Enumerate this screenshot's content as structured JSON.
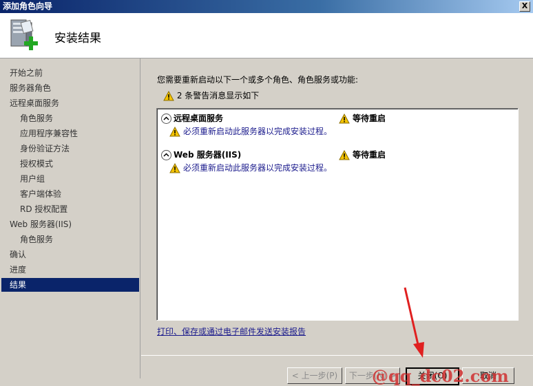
{
  "window": {
    "title": "添加角色向导",
    "close_glyph": "X"
  },
  "header": {
    "title": "安装结果",
    "icon": "server-add-icon"
  },
  "sidebar": {
    "items": [
      {
        "label": "开始之前",
        "sub": false,
        "active": false
      },
      {
        "label": "服务器角色",
        "sub": false,
        "active": false
      },
      {
        "label": "远程桌面服务",
        "sub": false,
        "active": false
      },
      {
        "label": "角色服务",
        "sub": true,
        "active": false
      },
      {
        "label": "应用程序兼容性",
        "sub": true,
        "active": false
      },
      {
        "label": "身份验证方法",
        "sub": true,
        "active": false
      },
      {
        "label": "授权模式",
        "sub": true,
        "active": false
      },
      {
        "label": "用户组",
        "sub": true,
        "active": false
      },
      {
        "label": "客户端体验",
        "sub": true,
        "active": false
      },
      {
        "label": "RD 授权配置",
        "sub": true,
        "active": false
      },
      {
        "label": "Web 服务器(IIS)",
        "sub": false,
        "active": false
      },
      {
        "label": "角色服务",
        "sub": true,
        "active": false
      },
      {
        "label": "确认",
        "sub": false,
        "active": false
      },
      {
        "label": "进度",
        "sub": false,
        "active": false
      },
      {
        "label": "结果",
        "sub": false,
        "active": true
      }
    ]
  },
  "main": {
    "prompt": "您需要重新启动以下一个或多个角色、角色服务或功能:",
    "warning_summary": "2 条警告消息显示如下",
    "results": [
      {
        "name": "远程桌面服务",
        "status": "等待重启",
        "message": "必须重新启动此服务器以完成安装过程。"
      },
      {
        "name": "Web 服务器(IIS)",
        "status": "等待重启",
        "message": "必须重新启动此服务器以完成安装过程。"
      }
    ],
    "report_link": "打印、保存或通过电子邮件发送安装报告"
  },
  "buttons": {
    "prev": "< 上一步(P)",
    "next": "下一步(N) >",
    "close": "关闭(O)",
    "cancel": "取消"
  },
  "watermark": "@qq_dc02.com",
  "colors": {
    "selection": "#0a246a",
    "link": "#1a1a8c",
    "annotation_arrow": "#e02020"
  }
}
